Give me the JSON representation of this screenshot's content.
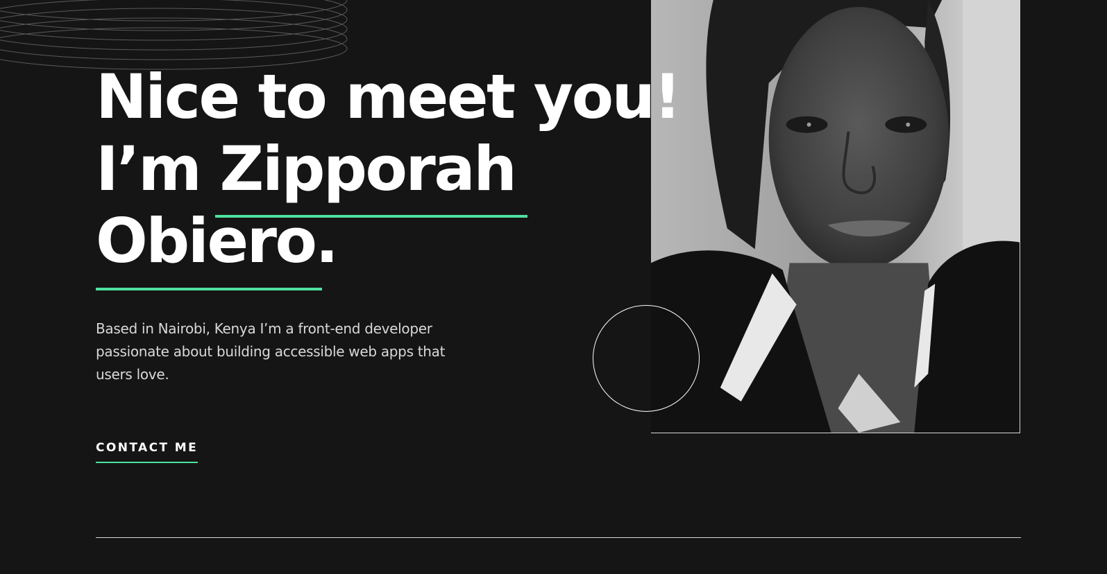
{
  "colors": {
    "background": "#151515",
    "accent": "#4ee1a0",
    "text": "#ffffff",
    "muted_text": "#d9d9d9"
  },
  "hero": {
    "headline_line1": "Nice to meet you!",
    "headline_line2": "I’m Zipporah",
    "headline_line3": "Obiero.",
    "intro": "Based in Nairobi, Kenya I’m a front-end developer passionate about building accessible web apps that users love.",
    "contact_label": "CONTACT ME"
  },
  "icons": {
    "rings": "rings-decoration-icon",
    "circle": "circle-decoration-icon"
  }
}
